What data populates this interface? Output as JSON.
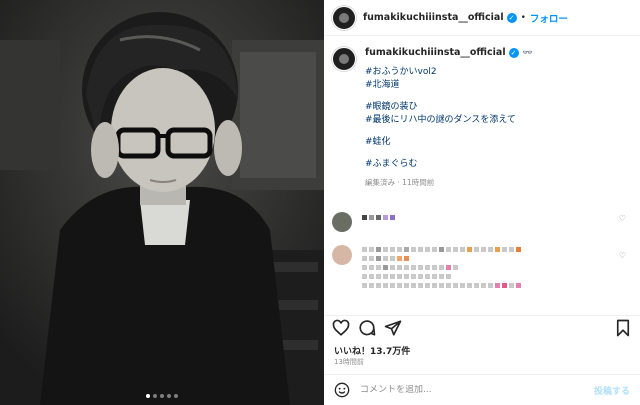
{
  "post": {
    "username": "fumakikuchiiinsta__official",
    "follow_label": "フォロー",
    "separator": "•",
    "username_emoji": "👓",
    "caption_lines": [
      "#おふうかいvol2",
      "#北海道",
      "",
      "#眼鏡の装ひ",
      "#最後にリハ中の謎のダンスを添えて",
      "",
      "#蛙化",
      "",
      "#ふまぐらむ"
    ],
    "caption_meta": "編集済み · 11時間前",
    "likes": "いいね！13.7万件",
    "time_ago": "13時間前",
    "comment_placeholder": "コメントを追加...",
    "post_label": "投稿する"
  },
  "carousel": {
    "count": 5,
    "active_index": 0
  },
  "icons": {
    "verified": "verified-badge-icon",
    "like": "heart-icon",
    "comment": "comment-bubble-icon",
    "share": "paper-plane-icon",
    "save": "bookmark-icon",
    "emoji": "smiley-icon",
    "comment_like": "small-heart-icon"
  },
  "colors": {
    "accent": "#0095f6",
    "text": "#262626",
    "hashtag": "#00376b",
    "muted": "#8e8e8e",
    "post_disabled": "#b2dffc"
  }
}
